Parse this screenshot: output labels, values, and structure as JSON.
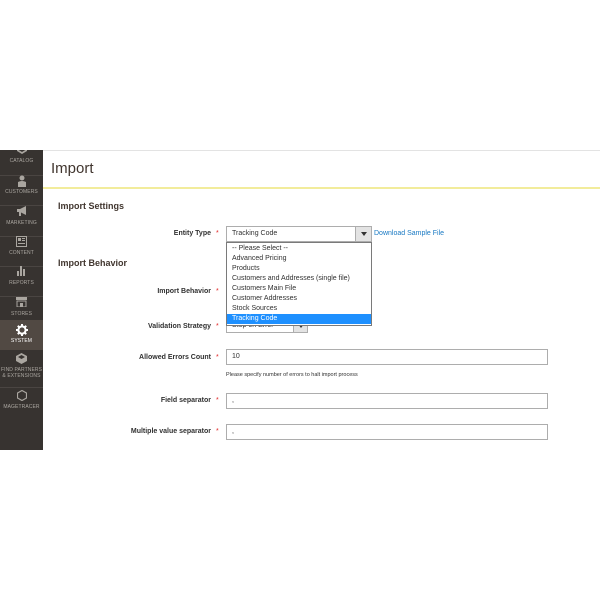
{
  "sidebar": {
    "items": [
      {
        "label": "CATALOG",
        "icon": "catalog-icon"
      },
      {
        "label": "CUSTOMERS",
        "icon": "customers-icon"
      },
      {
        "label": "MARKETING",
        "icon": "marketing-icon"
      },
      {
        "label": "CONTENT",
        "icon": "content-icon"
      },
      {
        "label": "REPORTS",
        "icon": "reports-icon"
      },
      {
        "label": "STORES",
        "icon": "stores-icon"
      },
      {
        "label": "SYSTEM",
        "icon": "system-icon",
        "active": true
      },
      {
        "label": "FIND PARTNERS & EXTENSIONS",
        "icon": "partners-icon"
      },
      {
        "label": "MAGETRACER",
        "icon": "magetracer-icon"
      }
    ]
  },
  "header": {
    "title": "Import"
  },
  "import_settings": {
    "title": "Import Settings",
    "entity_type": {
      "label": "Entity Type",
      "value": "Tracking Code",
      "download_link": "Download Sample File",
      "options": [
        "-- Please Select --",
        "Advanced Pricing",
        "Products",
        "Customers and Addresses (single file)",
        "Customers Main File",
        "Customer Addresses",
        "Stock Sources",
        "Tracking Code"
      ],
      "selected_option": "Tracking Code"
    }
  },
  "import_behavior": {
    "title": "Import Behavior",
    "behavior_label": "Import Behavior",
    "validation": {
      "label": "Validation Strategy",
      "value": "Stop on Error"
    },
    "allowed_errors": {
      "label": "Allowed Errors Count",
      "value": "10",
      "note": "Please specify number of errors to halt import process"
    },
    "field_separator": {
      "label": "Field separator",
      "value": ","
    },
    "multiple_separator": {
      "label": "Multiple value separator",
      "value": ","
    }
  },
  "required_marker": "*",
  "colors": {
    "sidebar_bg": "#373330",
    "accent_line": "#f2ec9b",
    "link": "#1979c3",
    "required": "#e22626",
    "selection": "#1e90ff"
  }
}
